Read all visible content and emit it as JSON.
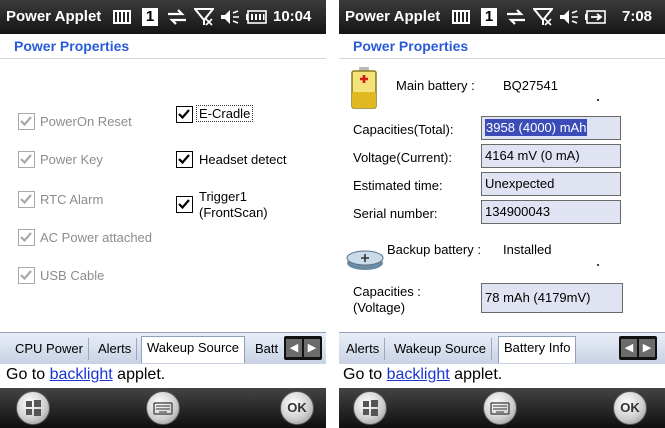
{
  "status": {
    "left_app_title": "Power Applet",
    "left_time": "10:04",
    "right_app_title": "Power Applet",
    "right_time": "7:08",
    "notification_badge": "1",
    "icons": [
      "notification-icon",
      "data-sync-icon",
      "no-signal-icon",
      "speaker-icon",
      "battery-icon"
    ]
  },
  "props_title": "Power Properties",
  "wakeup": {
    "left_items": [
      {
        "label": "PowerOn Reset",
        "checked": true,
        "enabled": false
      },
      {
        "label": "Power Key",
        "checked": true,
        "enabled": false
      },
      {
        "label": "RTC Alarm",
        "checked": true,
        "enabled": false
      },
      {
        "label": "AC Power attached",
        "checked": true,
        "enabled": false
      },
      {
        "label": "USB Cable",
        "checked": true,
        "enabled": false
      }
    ],
    "right_items": [
      {
        "label": "E-Cradle",
        "checked": true,
        "enabled": true,
        "focused": true
      },
      {
        "label": "Headset detect",
        "checked": true,
        "enabled": true
      },
      {
        "label_line1": "Trigger1",
        "label_line2": "(FrontScan)",
        "checked": true,
        "enabled": true
      }
    ]
  },
  "battery": {
    "main_label": "Main battery :",
    "main_value": "BQ27541",
    "fields": [
      {
        "label": "Capacities(Total):",
        "value": "3958 (4000) mAh",
        "selected": true
      },
      {
        "label": "Voltage(Current):",
        "value": "4164 mV (0 mA)"
      },
      {
        "label": "Estimated time:",
        "value": "Unexpected"
      },
      {
        "label": "Serial number:",
        "value": "134900043"
      }
    ],
    "backup_label": "Backup battery :",
    "backup_value": "Installed",
    "backup_cap_label_line1": "Capacities :",
    "backup_cap_label_line2": "(Voltage)",
    "backup_cap_value": "78 mAh (4179mV)"
  },
  "left_tabs": [
    "CPU Power",
    "Alerts",
    "Wakeup Source",
    "Batt"
  ],
  "left_active_tab": "Wakeup Source",
  "right_tabs": [
    "Alerts",
    "Wakeup Source",
    "Battery Info"
  ],
  "right_active_tab": "Battery Info",
  "footer": {
    "prefix": "Go to ",
    "link": "backlight",
    "suffix": " applet."
  },
  "softkeys": {
    "ok": "OK"
  },
  "colors": {
    "accent": "#2a5bd7",
    "link": "#1a34d6",
    "statusbar": "#1e1e1e",
    "selection": "#3b4cb8",
    "field_bg": "#dfe3f2"
  }
}
